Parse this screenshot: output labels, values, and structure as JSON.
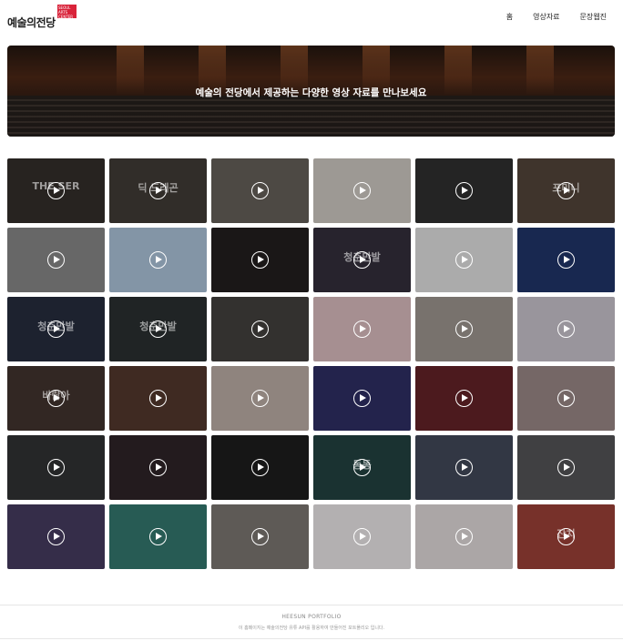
{
  "header": {
    "logo_text": "예술의전당",
    "logo_mark": "SEOUL ARTS CENTER",
    "nav": [
      "홈",
      "영상자료",
      "문장웹진"
    ]
  },
  "hero": {
    "title": "예술의 전당에서 제공하는 다양한 영상 자료를 만나보세요"
  },
  "videos": [
    {
      "bg": "#2e2a26",
      "caption": "THE SER"
    },
    {
      "bg": "#3a3531",
      "caption": "딕 드래곤"
    },
    {
      "bg": "#5b5650",
      "caption": ""
    },
    {
      "bg": "#b9b4ae",
      "caption": ""
    },
    {
      "bg": "#2b2b2b",
      "caption": ""
    },
    {
      "bg": "#4a3e34",
      "caption": "포미니"
    },
    {
      "bg": "#7a7a7a",
      "caption": ""
    },
    {
      "bg": "#9ab0c4",
      "caption": ""
    },
    {
      "bg": "#1f1c1c",
      "caption": ""
    },
    {
      "bg": "#2e2a36",
      "caption": "청춘만발"
    },
    {
      "bg": "#c9c9c9",
      "caption": ""
    },
    {
      "bg": "#1d2f5e",
      "caption": ""
    },
    {
      "bg": "#232838",
      "caption": "청춘만발"
    },
    {
      "bg": "#262b2c",
      "caption": "청춘만발"
    },
    {
      "bg": "#3d3a38",
      "caption": ""
    },
    {
      "bg": "#c4a9ab",
      "caption": ""
    },
    {
      "bg": "#8e8680",
      "caption": ""
    },
    {
      "bg": "#b4afb8",
      "caption": ""
    },
    {
      "bg": "#3b2e2a",
      "caption": "바람아"
    },
    {
      "bg": "#4a3229",
      "caption": ""
    },
    {
      "bg": "#a89c94",
      "caption": ""
    },
    {
      "bg": "#2a2a5a",
      "caption": ""
    },
    {
      "bg": "#5a1f24",
      "caption": ""
    },
    {
      "bg": "#8a7a78",
      "caption": ""
    },
    {
      "bg": "#2c2d2e",
      "caption": ""
    },
    {
      "bg": "#2a2024",
      "caption": ""
    },
    {
      "bg": "#1b1b1b",
      "caption": ""
    },
    {
      "bg": "#1f3b3a",
      "caption": "동동"
    },
    {
      "bg": "#3b4150",
      "caption": ""
    },
    {
      "bg": "#4c4c4e",
      "caption": ""
    },
    {
      "bg": "#3f3656",
      "caption": ""
    },
    {
      "bg": "#2e6b63",
      "caption": ""
    },
    {
      "bg": "#6f6a66",
      "caption": ""
    },
    {
      "bg": "#d3cfd0",
      "caption": ""
    },
    {
      "bg": "#c9c4c4",
      "caption": ""
    },
    {
      "bg": "#8c3a32",
      "caption": "잔치"
    }
  ],
  "footer": {
    "brand": "HEESUN PORTFOLIO",
    "note": "이 홈페이지는 예술의전당 유튜 API를 활용하여 만들어진 포트폴리오 입니다."
  }
}
